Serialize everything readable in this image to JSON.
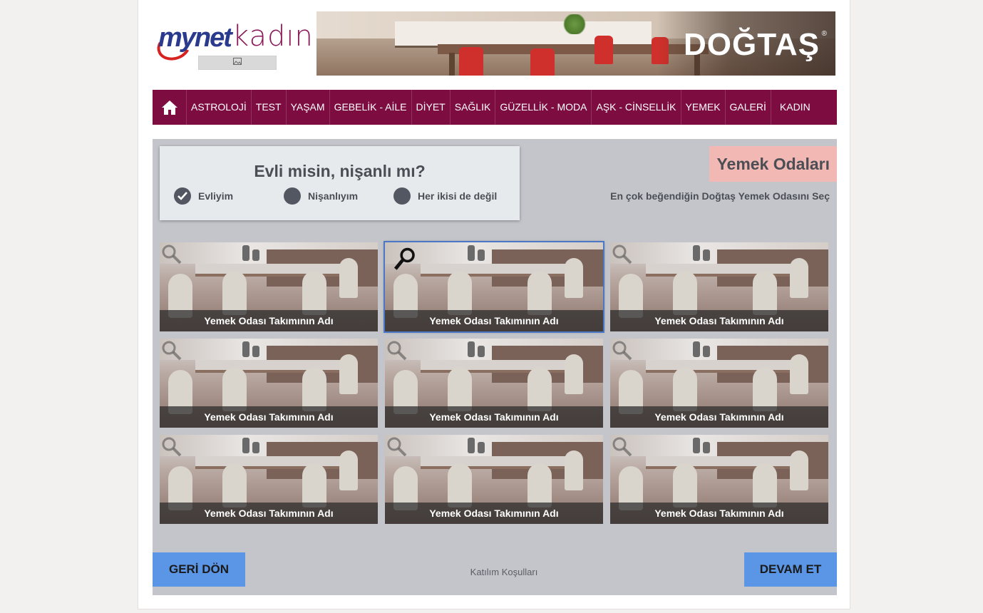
{
  "header": {
    "logo_mynet": "mynet",
    "logo_kadin": "kadın",
    "logo_sub_icon": "image-icon",
    "banner_brand": "DOĞTAŞ",
    "banner_reg": "®"
  },
  "nav": {
    "home_icon": "home-icon",
    "items": [
      "ASTROLOJİ",
      "TEST",
      "YAŞAM",
      "GEBELİK - AİLE",
      "DİYET",
      "SAĞLIK",
      "GÜZELLİK - MODA",
      "AŞK - CİNSELLİK",
      "YEMEK",
      "GALERİ",
      "KADIN"
    ]
  },
  "poll": {
    "question": "Evli misin, nişanlı mı?",
    "options": [
      {
        "label": "Evliyim",
        "selected": true
      },
      {
        "label": "Nişanlıyım",
        "selected": false
      },
      {
        "label": "Her ikisi de değil",
        "selected": false
      }
    ]
  },
  "section": {
    "title": "Yemek Odaları",
    "subtitle": "En çok beğendiğin Doğtaş Yemek Odasını Seç"
  },
  "cards": [
    {
      "caption": "Yemek Odası Takımının Adı",
      "active": false
    },
    {
      "caption": "Yemek Odası Takımının Adı",
      "active": true
    },
    {
      "caption": "Yemek Odası Takımının Adı",
      "active": false
    },
    {
      "caption": "Yemek Odası Takımının Adı",
      "active": false
    },
    {
      "caption": "Yemek Odası Takımının Adı",
      "active": false
    },
    {
      "caption": "Yemek Odası Takımının Adı",
      "active": false
    },
    {
      "caption": "Yemek Odası Takımının Adı",
      "active": false
    },
    {
      "caption": "Yemek Odası Takımının Adı",
      "active": false
    },
    {
      "caption": "Yemek Odası Takımının Adı",
      "active": false
    }
  ],
  "footer": {
    "back_label": "GERİ DÖN",
    "next_label": "DEVAM ET",
    "terms_label": "Katılım Koşulları"
  },
  "colors": {
    "nav_bg": "#7d0c40",
    "content_bg": "#c3c5cb",
    "button_bg": "#5b95e5",
    "badge_bg": "#f2b8b4"
  }
}
